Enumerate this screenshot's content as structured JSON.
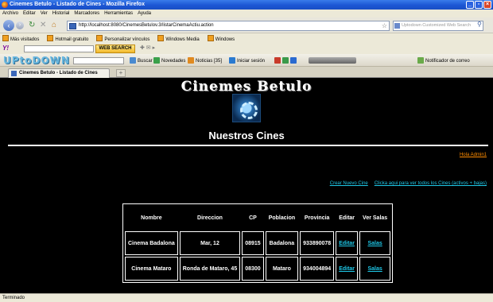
{
  "window": {
    "title": "Cinemes Betulo - Listado de Cines - Mozilla Firefox"
  },
  "menu": [
    "Archivo",
    "Editar",
    "Ver",
    "Historial",
    "Marcadores",
    "Herramientas",
    "Ayuda"
  ],
  "nav": {
    "url": "http://localhost:8080/CinemesBetulov.3/listarCinemaActiu.action",
    "search_placeholder": "Uptodown Customized Web Search"
  },
  "bookmarks": [
    "Más visitados",
    "Hotmail gratuito",
    "Personalizar vínculos",
    "Windows Media",
    "Windows"
  ],
  "yahoo_toolbar": {
    "logo": "Y!",
    "web_search": "WEB SEARCH"
  },
  "uptodown_toolbar": {
    "logo": "UPtoDOWN",
    "items": [
      "Buscar",
      "Novedades",
      "Noticias [35]",
      "Iniciar sesión",
      "Notificador de correo"
    ]
  },
  "tab": {
    "label": "Cinemes Betulo - Listado de Cines",
    "new_tab": "+"
  },
  "page": {
    "site_title": "Cinemes Betulo",
    "subtitle": "Nuestros Cines",
    "greeting": "Hola Admin1",
    "create_link": "Crear Nuevo Cine",
    "all_link": "Clicka aqui para ver todos los Cines (activos + bajas)",
    "table": {
      "headers": [
        "Nombre",
        "Direccion",
        "CP",
        "Poblacion",
        "Provincia",
        "Editar",
        "Ver Salas"
      ],
      "rows": [
        {
          "nombre": "Cinema Badalona",
          "direccion": "Mar, 12",
          "cp": "08915",
          "poblacion": "Badalona",
          "provincia": "933890078",
          "editar": "Editar",
          "salas": "Salas"
        },
        {
          "nombre": "Cinema Mataro",
          "direccion": "Ronda de Mataro, 45",
          "cp": "08300",
          "poblacion": "Mataro",
          "provincia": "934004894",
          "editar": "Editar",
          "salas": "Salas"
        }
      ]
    }
  },
  "status": "Terminado",
  "colors": {
    "accent_link": "#1ec8e8",
    "greeting": "#ff8c00",
    "page_bg": "#000000"
  }
}
